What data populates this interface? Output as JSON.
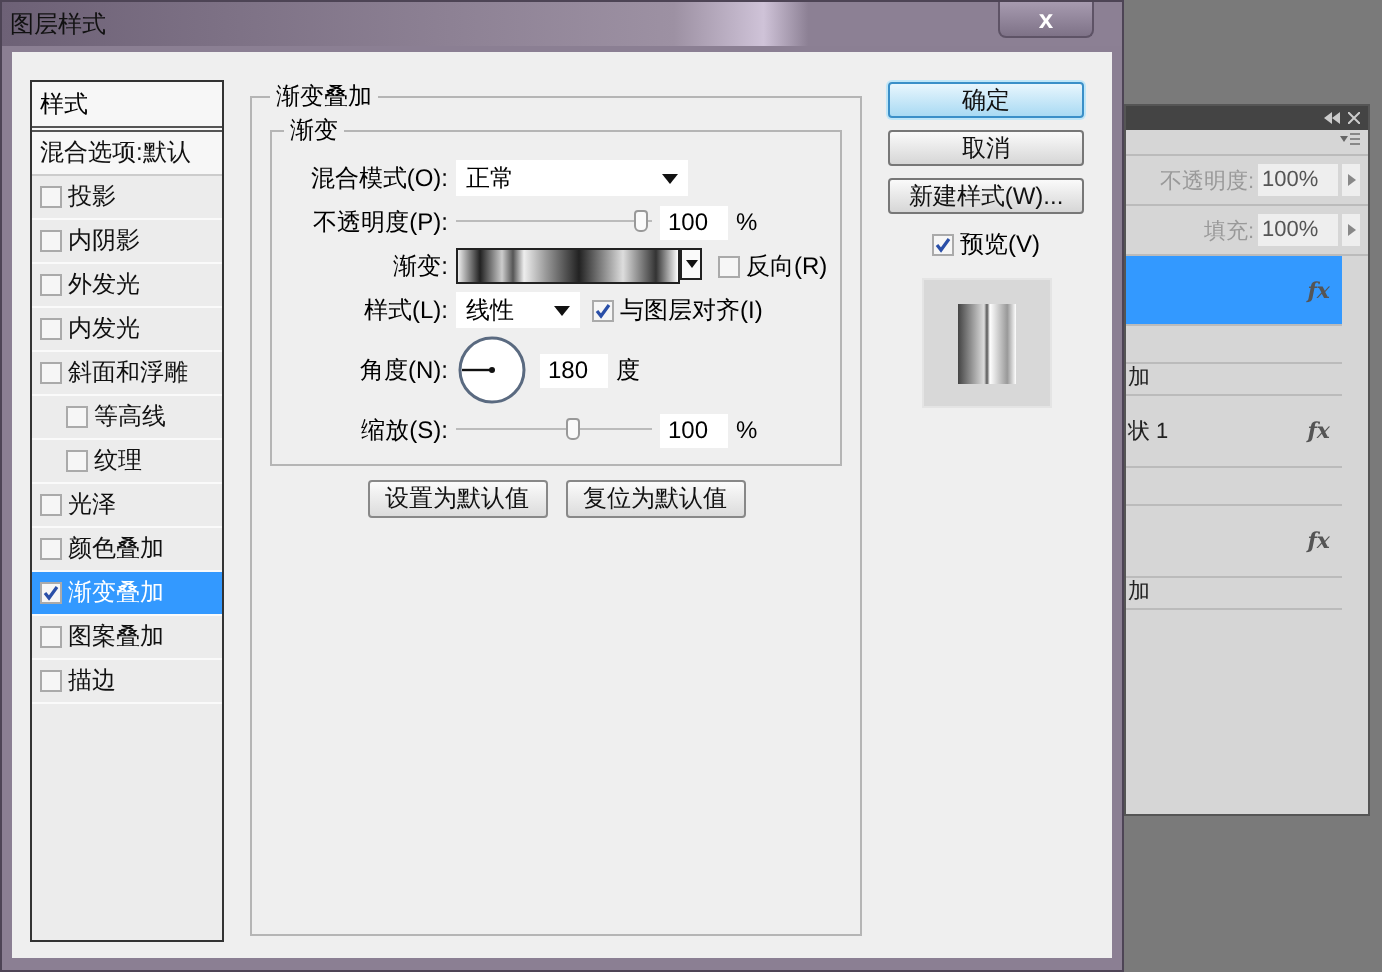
{
  "dialog": {
    "title": "图层样式",
    "close": "x"
  },
  "styles_list": {
    "header": "样式",
    "items": [
      {
        "kind": "plain",
        "label": "混合选项:默认",
        "selected": false
      },
      {
        "kind": "check",
        "label": "投影",
        "checked": false,
        "selected": false
      },
      {
        "kind": "check",
        "label": "内阴影",
        "checked": false,
        "selected": false
      },
      {
        "kind": "check",
        "label": "外发光",
        "checked": false,
        "selected": false
      },
      {
        "kind": "check",
        "label": "内发光",
        "checked": false,
        "selected": false
      },
      {
        "kind": "check",
        "label": "斜面和浮雕",
        "checked": false,
        "selected": false,
        "children": [
          {
            "kind": "check",
            "label": "等高线",
            "checked": false,
            "selected": false
          },
          {
            "kind": "check",
            "label": "纹理",
            "checked": false,
            "selected": false
          }
        ]
      },
      {
        "kind": "check",
        "label": "光泽",
        "checked": false,
        "selected": false
      },
      {
        "kind": "check",
        "label": "颜色叠加",
        "checked": false,
        "selected": false
      },
      {
        "kind": "check",
        "label": "渐变叠加",
        "checked": true,
        "selected": true
      },
      {
        "kind": "check",
        "label": "图案叠加",
        "checked": false,
        "selected": false
      },
      {
        "kind": "check",
        "label": "描边",
        "checked": false,
        "selected": false
      }
    ]
  },
  "gradient_overlay": {
    "title": "渐变叠加",
    "group_title": "渐变",
    "blend_mode": {
      "label": "混合模式(O):",
      "value": "正常"
    },
    "opacity": {
      "label": "不透明度(P):",
      "level": 0.95,
      "value": "100",
      "unit": "%"
    },
    "gradient": {
      "label": "渐变:"
    },
    "reverse": {
      "label": "反向(R)",
      "checked": false
    },
    "style": {
      "label": "样式(L):",
      "value": "线性"
    },
    "align": {
      "label": "与图层对齐(I)",
      "checked": true
    },
    "angle": {
      "label": "角度(N):",
      "value": "180",
      "unit": "度"
    },
    "scale": {
      "label": "缩放(S):",
      "level": 0.6,
      "value": "100",
      "unit": "%"
    },
    "buttons": [
      "设置为默认值",
      "复位为默认值"
    ]
  },
  "actions": {
    "buttons": [
      {
        "label": "确定",
        "default": true
      },
      {
        "label": "取消",
        "default": false
      },
      {
        "label": "新建样式(W)...",
        "default": false
      }
    ],
    "preview": {
      "label": "预览(V)",
      "checked": true
    }
  },
  "layers_panel": {
    "opacity": {
      "label": "不透明度:",
      "value": "100%"
    },
    "fill": {
      "label": "填充:",
      "value": "100%"
    },
    "rows": [
      {
        "kind": "layer",
        "fx": "fx",
        "selected": true
      },
      {
        "kind": "effect",
        "text": "加"
      },
      {
        "kind": "layer",
        "name": "状 1",
        "fx": "fx",
        "selected": false
      },
      {
        "kind": "layer",
        "fx": "fx",
        "selected": false
      },
      {
        "kind": "effect",
        "text": "加"
      }
    ]
  }
}
